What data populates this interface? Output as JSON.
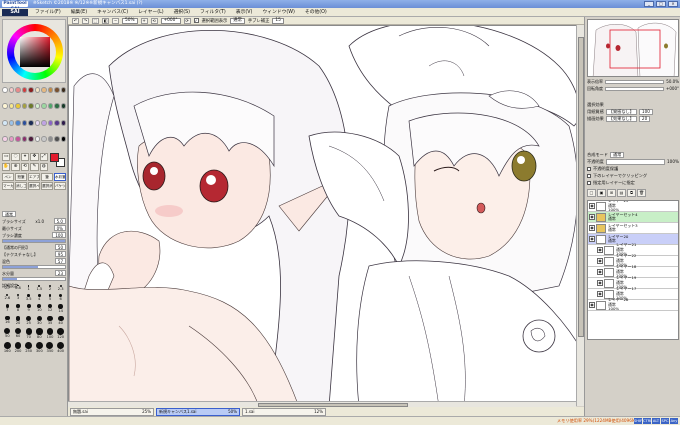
{
  "window": {
    "logo": "PaintTool SAI",
    "title": "※Sketch ©2018※ ※/12※※新規キャンバス1.sai (?)",
    "controls": [
      "_",
      "□",
      "×"
    ]
  },
  "menu": {
    "logo": "SAI",
    "items": [
      "ファイル(F)",
      "編集(E)",
      "キャンバス(C)",
      "レイヤー(L)",
      "選択(S)",
      "フィルタ(T)",
      "表示(V)",
      "ウィンドウ(W)",
      "その他(O)"
    ]
  },
  "toolbar": {
    "zoom_value": "50%",
    "rotation_value": "+000°",
    "stabilizer_label": "手ブレ補正",
    "stabilizer_value": "15",
    "antialias_label": "選択範囲表示",
    "normal_label": "通常"
  },
  "tools": {
    "select_icons": [
      "▭",
      "◌",
      "⌖",
      "✥",
      "⤢"
    ],
    "transform_icons": [
      "✋",
      "⊕",
      "⟲",
      "✎",
      "◍"
    ],
    "brush_tabs": [
      "ペン",
      "鉛筆",
      "エアブラシ",
      "筆",
      "水彩筆",
      "マーカー",
      "消しゴム",
      "選択ペン",
      "選択消し",
      "バケツ"
    ]
  },
  "colors": {
    "foreground": "#e21b2d",
    "palette": [
      "#ffffff",
      "#f4c9c9",
      "#e88a8a",
      "#d23d3d",
      "#8a1e1e",
      "#f4e3c3",
      "#e6b981",
      "#c38b4a",
      "#7a5230",
      "#3a2a1a",
      "#fff6d5",
      "#f7e78c",
      "#e8c837",
      "#a6a13f",
      "#6d7a2a",
      "#d5f1cf",
      "#9cd7a0",
      "#4fa86b",
      "#2f6e45",
      "#173a27",
      "#d4e8f7",
      "#9bc3ea",
      "#4e86cf",
      "#2b4f9c",
      "#1a2b55",
      "#e6d8f4",
      "#c0a3e4",
      "#8b63c7",
      "#5a3a8c",
      "#2e1b4a",
      "#f5d0e6",
      "#e79ac7",
      "#c5569a",
      "#8b2f6a",
      "#4e1b3b",
      "#f0f0f0",
      "#c8c8c8",
      "#909090",
      "#505050",
      "#000000"
    ]
  },
  "brush": {
    "mode_label": "通常",
    "size_label": "ブラシサイズ",
    "size_value": "5.0",
    "size_multiplier": "x1.0",
    "min_size_label": "最小サイズ",
    "min_size_value": "0%",
    "density_label": "ブラシ濃度",
    "density_value": "100",
    "texture_label": "【通常の円形】",
    "texture_strength": "50",
    "blend_label": "【テクスチャなし】",
    "blend_value": "95",
    "blending_label": "混色",
    "blending_value": "57",
    "dilution_label": "水分量",
    "dilution_value": "23",
    "detail_label": "詳細設定",
    "sizes": [
      "0.7",
      "0.8",
      "1",
      "1.5",
      "2",
      "2.3",
      "2.6",
      "3",
      "3.5",
      "4",
      "5",
      "6",
      "7",
      "8",
      "9",
      "10",
      "12",
      "14",
      "16",
      "20",
      "25",
      "30",
      "35",
      "40",
      "50",
      "60",
      "70",
      "80",
      "100",
      "120",
      "160",
      "200",
      "250",
      "300",
      "350",
      "400"
    ],
    "size_fractions": [
      0.05,
      0.07,
      0.09,
      0.12,
      0.15,
      0.17,
      0.2,
      0.22,
      0.25,
      0.28,
      0.32,
      0.36,
      0.4,
      0.43,
      0.46,
      0.5,
      0.54,
      0.58,
      0.62,
      0.66,
      0.7,
      0.73,
      0.76,
      0.79,
      0.82,
      0.85,
      0.88,
      0.9,
      0.92,
      0.94,
      0.96,
      0.97,
      0.98,
      0.99,
      1.0,
      1.0
    ]
  },
  "navigator": {
    "zoom_label": "表示倍率",
    "zoom_value": "50.0%",
    "angle_label": "回転角度",
    "angle_value": "+000°"
  },
  "selection": {
    "section_label": "選択効果",
    "paper_label": "用紙質感",
    "paper_value": "【質感なし】",
    "strength_value": "100",
    "effect_label": "描画効果",
    "effect_value": "【効果なし】",
    "effect_strength": "20"
  },
  "layer_props": {
    "blend_label": "合成モード",
    "blend_value": "通常",
    "opacity_label": "不透明度",
    "opacity_value": "100%",
    "protect_label": "不透明度保護",
    "clipping_label": "下のレイヤーでクリッピング",
    "sample_label": "指定用レイヤーに指定"
  },
  "layer_tools": [
    "□",
    "▣",
    "⊞",
    "▤",
    "⧉",
    "🗑"
  ],
  "layers": [
    {
      "name": "レイヤー23",
      "mode": "通常",
      "opacity": "100%",
      "type": "layer",
      "state": ""
    },
    {
      "name": "レイヤーセット4",
      "mode": "通常",
      "opacity": "",
      "type": "folder",
      "state": "group"
    },
    {
      "name": "レイヤーセット3",
      "mode": "通常",
      "opacity": "",
      "type": "folder",
      "state": ""
    },
    {
      "name": "レイヤー20",
      "mode": "通常",
      "opacity": "",
      "type": "layer",
      "state": "selected"
    },
    {
      "name": "レイヤー21",
      "mode": "通常",
      "opacity": "100%",
      "type": "layer",
      "state": "indent"
    },
    {
      "name": "レイヤー22",
      "mode": "通常",
      "opacity": "100%",
      "type": "layer",
      "state": "indent"
    },
    {
      "name": "レイヤー18",
      "mode": "通常",
      "opacity": "100%",
      "type": "layer",
      "state": "indent"
    },
    {
      "name": "レイヤー19",
      "mode": "通常",
      "opacity": "100%",
      "type": "layer",
      "state": "indent"
    },
    {
      "name": "レイヤー17",
      "mode": "通常",
      "opacity": "100%",
      "type": "layer",
      "state": "indent"
    },
    {
      "name": "レイヤー26",
      "mode": "通常",
      "opacity": "100%",
      "type": "layer",
      "state": ""
    }
  ],
  "documents": [
    {
      "name": "無題.sai",
      "zoom": "25%",
      "active": false
    },
    {
      "name": "新規キャンバス1.sai",
      "zoom": "50%",
      "active": true
    },
    {
      "name": "1.sai",
      "zoom": "12%",
      "active": false
    }
  ],
  "status": {
    "memory": "メモリ使用率 29%(1224MB使用/4096MB)",
    "indicators": [
      "SHIFT",
      "CTRL",
      "ALT",
      "SPC",
      "Any"
    ]
  }
}
